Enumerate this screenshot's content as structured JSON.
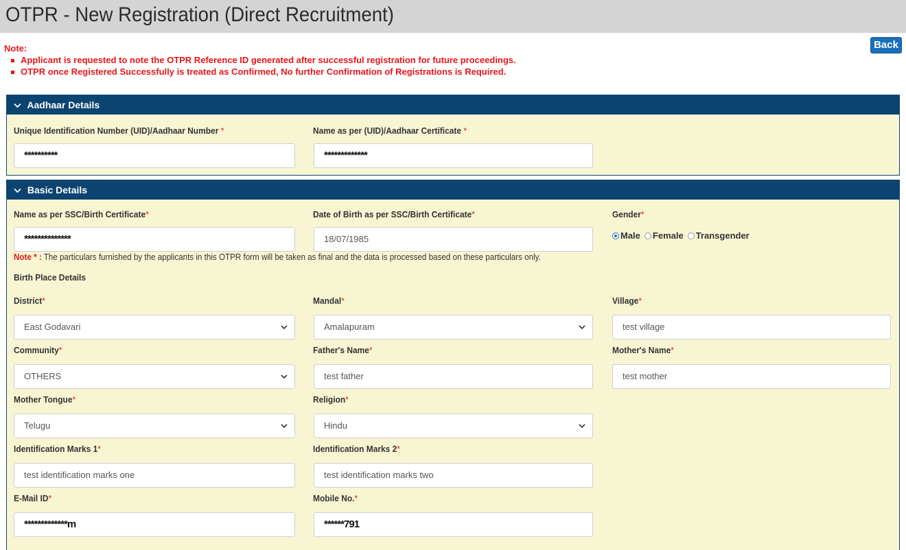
{
  "page": {
    "title": "OTPR - New Registration (Direct Recruitment)",
    "back_label": "Back"
  },
  "notes": {
    "label": "Note:",
    "items": [
      "Applicant is requested to note the OTPR Reference ID generated after successful registration for future proceedings.",
      "OTPR once Registered Successfully is treated as Confirmed, No further Confirmation of Registrations is Required."
    ]
  },
  "aadhaar": {
    "header": "Aadhaar Details",
    "uid_label": "Unique Identification Number (UID)/Aadhaar Number",
    "uid_value": "**********",
    "name_label": "Name as per (UID)/Aadhaar Certificate",
    "name_value": "*************"
  },
  "basic": {
    "header": "Basic Details",
    "name_label": "Name as per SSC/Birth Certificate",
    "name_value": "**************",
    "dob_label": "Date of Birth as per SSC/Birth Certificate",
    "dob_value": "18/07/1985",
    "gender_label": "Gender",
    "gender_options": [
      "Male",
      "Female",
      "Transgender"
    ],
    "gender_selected": "Male",
    "note_prefix": "Note * :",
    "note_text": "The particulars furnished by the applicants in this OTPR form will be taken as final and the data is processed based on these particulars only.",
    "birth_place_heading": "Birth Place Details",
    "district_label": "District",
    "district_value": "East Godavari",
    "mandal_label": "Mandal",
    "mandal_value": "Amalapuram",
    "village_label": "Village",
    "village_value": "test village",
    "community_label": "Community",
    "community_value": "OTHERS",
    "father_label": "Father's Name",
    "father_value": "test father",
    "mother_label": "Mother's Name",
    "mother_value": "test mother",
    "tongue_label": "Mother Tongue",
    "tongue_value": "Telugu",
    "religion_label": "Religion",
    "religion_value": "Hindu",
    "idmark1_label": "Identification Marks 1",
    "idmark1_value": "test identification marks one",
    "idmark2_label": "Identification Marks 2",
    "idmark2_value": "test identification marks two",
    "email_label": "E-Mail ID",
    "email_value": "*************m",
    "mobile_label": "Mobile No.",
    "mobile_value": "******791"
  },
  "colors": {
    "header_bg": "#0b4470",
    "panel_bg": "#f8f5d3",
    "note_red": "#e8151a",
    "button_blue": "#1a70b8"
  }
}
